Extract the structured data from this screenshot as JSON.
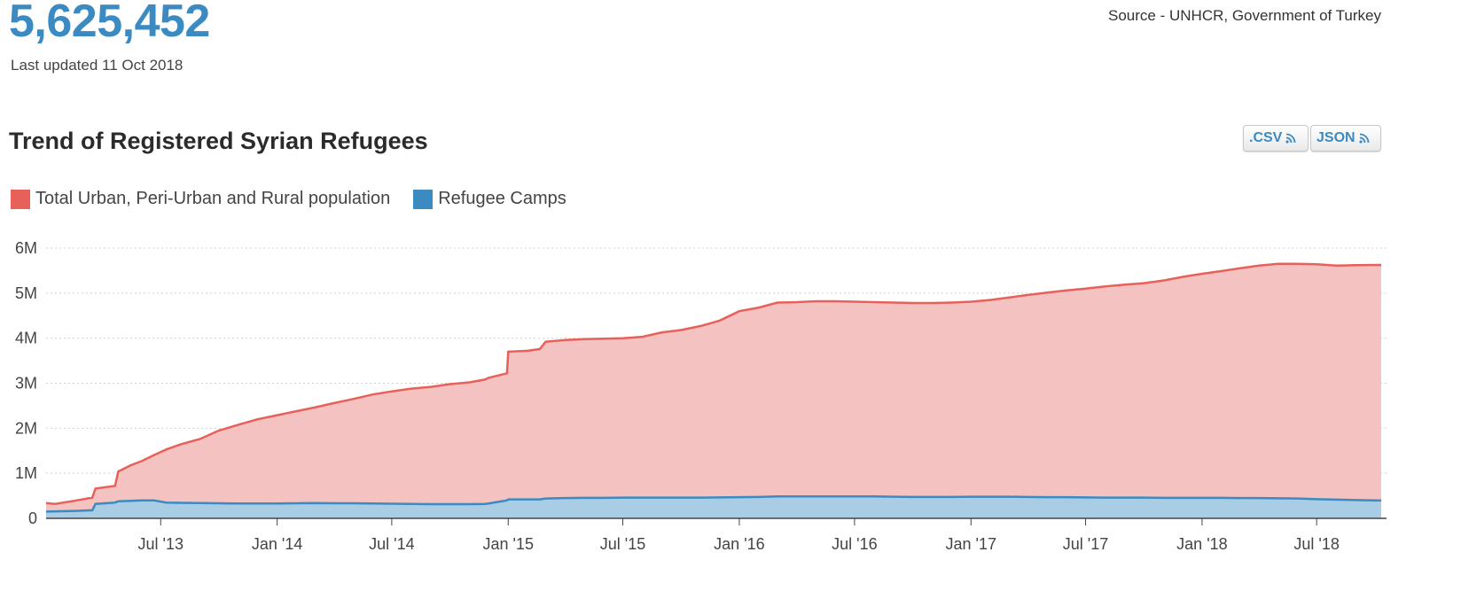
{
  "header": {
    "total": "5,625,452",
    "last_updated": "Last updated 11 Oct 2018",
    "source": "Source - UNHCR, Government of Turkey"
  },
  "downloads": {
    "csv_label": ".CSV",
    "json_label": "JSON"
  },
  "colors": {
    "urban": "#e8605a",
    "urban_fill": "#f4c2c0",
    "camps": "#3b8bc2",
    "camps_fill": "#a9cde4",
    "accent": "#3b8bc2"
  },
  "icons": {
    "download": "rss-icon"
  },
  "chart_data": {
    "type": "area",
    "title": "Trend of Registered Syrian Refugees",
    "stacked": true,
    "x_tick_labels": [
      "Jul '13",
      "Jan '14",
      "Jul '14",
      "Jan '15",
      "Jul '15",
      "Jan '16",
      "Jul '16",
      "Jan '17",
      "Jul '17",
      "Jan '18",
      "Jul '18"
    ],
    "x_ticks": [
      "2013-07-01",
      "2014-01-01",
      "2014-07-01",
      "2015-01-01",
      "2015-07-01",
      "2016-01-01",
      "2016-07-01",
      "2017-01-01",
      "2017-07-01",
      "2018-01-01",
      "2018-07-01"
    ],
    "y_tick_labels": [
      "0",
      "1M",
      "2M",
      "3M",
      "4M",
      "5M",
      "6M"
    ],
    "y_ticks": [
      0,
      1000000,
      2000000,
      3000000,
      4000000,
      5000000,
      6000000
    ],
    "xlim": [
      "2013-01-01",
      "2018-10-11"
    ],
    "ylim": [
      0,
      6000000
    ],
    "grid": "horizontal dotted",
    "legend_position": "top-left",
    "x": [
      "2013-01-01",
      "2013-01-15",
      "2013-02-15",
      "2013-03-15",
      "2013-03-20",
      "2013-04-20",
      "2013-04-25",
      "2013-05-15",
      "2013-06-01",
      "2013-06-20",
      "2013-07-10",
      "2013-08-01",
      "2013-09-01",
      "2013-10-01",
      "2013-11-01",
      "2013-12-01",
      "2014-01-01",
      "2014-02-01",
      "2014-03-01",
      "2014-04-01",
      "2014-05-01",
      "2014-06-01",
      "2014-07-01",
      "2014-08-01",
      "2014-09-01",
      "2014-10-01",
      "2014-11-01",
      "2014-11-25",
      "2014-12-01",
      "2014-12-30",
      "2015-01-01",
      "2015-02-01",
      "2015-02-20",
      "2015-03-01",
      "2015-04-01",
      "2015-05-01",
      "2015-06-01",
      "2015-07-01",
      "2015-08-01",
      "2015-09-01",
      "2015-10-01",
      "2015-11-01",
      "2015-12-01",
      "2016-01-01",
      "2016-02-01",
      "2016-03-01",
      "2016-04-01",
      "2016-05-01",
      "2016-06-01",
      "2016-07-01",
      "2016-08-01",
      "2016-09-01",
      "2016-10-01",
      "2016-11-01",
      "2016-12-01",
      "2017-01-01",
      "2017-02-01",
      "2017-03-01",
      "2017-04-01",
      "2017-05-01",
      "2017-06-01",
      "2017-07-01",
      "2017-08-01",
      "2017-09-01",
      "2017-10-01",
      "2017-11-01",
      "2017-12-01",
      "2018-01-01",
      "2018-02-01",
      "2018-03-01",
      "2018-04-01",
      "2018-05-01",
      "2018-06-01",
      "2018-07-01",
      "2018-08-01",
      "2018-09-01",
      "2018-10-11"
    ],
    "series": [
      {
        "name": "Total Urban, Peri-Urban and Rural population",
        "values": [
          340000,
          320000,
          390000,
          460000,
          660000,
          720000,
          1040000,
          1180000,
          1270000,
          1400000,
          1530000,
          1640000,
          1760000,
          1950000,
          2080000,
          2200000,
          2290000,
          2380000,
          2460000,
          2560000,
          2650000,
          2750000,
          2820000,
          2880000,
          2920000,
          2980000,
          3020000,
          3080000,
          3120000,
          3220000,
          3700000,
          3720000,
          3760000,
          3920000,
          3960000,
          3980000,
          3990000,
          4000000,
          4030000,
          4130000,
          4180000,
          4270000,
          4390000,
          4600000,
          4680000,
          4790000,
          4800000,
          4820000,
          4820000,
          4810000,
          4800000,
          4790000,
          4780000,
          4780000,
          4790000,
          4810000,
          4850000,
          4900000,
          4960000,
          5010000,
          5060000,
          5100000,
          5150000,
          5190000,
          5220000,
          5280000,
          5360000,
          5430000,
          5490000,
          5550000,
          5610000,
          5650000,
          5650000,
          5640000,
          5610000,
          5620000,
          5625452
        ]
      },
      {
        "name": "Refugee Camps",
        "values": [
          150000,
          155000,
          165000,
          180000,
          320000,
          350000,
          380000,
          390000,
          400000,
          400000,
          350000,
          345000,
          340000,
          335000,
          330000,
          330000,
          330000,
          335000,
          340000,
          335000,
          335000,
          330000,
          325000,
          320000,
          315000,
          315000,
          315000,
          320000,
          330000,
          400000,
          420000,
          420000,
          420000,
          440000,
          450000,
          455000,
          455000,
          460000,
          460000,
          460000,
          460000,
          460000,
          465000,
          470000,
          475000,
          485000,
          485000,
          485000,
          485000,
          485000,
          485000,
          480000,
          475000,
          475000,
          475000,
          480000,
          480000,
          480000,
          475000,
          470000,
          470000,
          465000,
          460000,
          460000,
          460000,
          455000,
          455000,
          455000,
          455000,
          450000,
          450000,
          445000,
          440000,
          425000,
          415000,
          405000,
          395000
        ]
      }
    ]
  }
}
